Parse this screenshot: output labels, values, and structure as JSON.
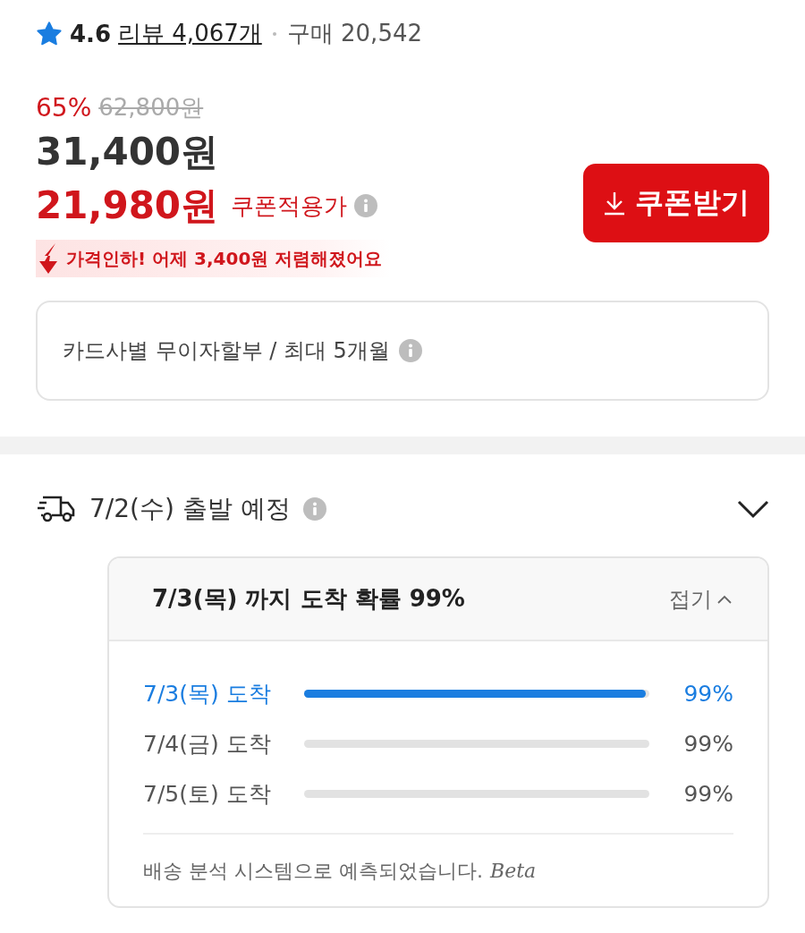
{
  "rating": {
    "score": "4.6",
    "reviews": "리뷰 4,067개",
    "purchases": "구매 20,542"
  },
  "price": {
    "discount": "65%",
    "original": "62,800원",
    "sale": "31,400원",
    "coupon_price": "21,980원",
    "coupon_label": "쿠폰적용가",
    "drop_notice": "가격인하! 어제 3,400원 저렴해졌어요"
  },
  "coupon_button": {
    "label": "쿠폰받기"
  },
  "installment": {
    "text": "카드사별 무이자할부 / 최대 5개월"
  },
  "shipping": {
    "departure": "7/2(수) 출발 예정",
    "expanded": true,
    "panel": {
      "title": "7/3(목) 까지 도착 확률 99%",
      "collapse": "접기",
      "rows": [
        {
          "label": "7/3(목) 도착",
          "level": 0.99,
          "reading": "99%",
          "selected": true
        },
        {
          "label": "7/4(금) 도착",
          "reading": "99%",
          "selected": false
        },
        {
          "label": "7/5(토) 도착",
          "reading": "99%",
          "selected": false
        }
      ],
      "footnote": "배송 분석 시스템으로 예측되었습니다.",
      "beta": "Beta"
    }
  }
}
